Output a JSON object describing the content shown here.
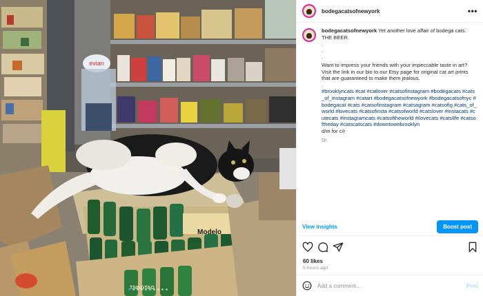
{
  "header": {
    "username": "bodegacatsofnewyork",
    "more_label": "•••"
  },
  "caption": {
    "username": "bodegacatsofnewyork",
    "line1": "Yet another love affair of bodega cats.",
    "line2": "THE BEER.",
    "dots": [
      ".",
      ".",
      "."
    ],
    "body": "Want to impress your friends with your impeccable taste in art? Visit the link in our bio to our Etsy page for original cat art prints that are guaranteed to make them jealous.",
    "dot4": ".",
    "hashtags": "#brooklyncats #cat #catlover #catsofinstagram #bodegacats #cats_of_instagram #catart #bodegacatsofnewyork #bodegacatsofnyc #bodegacat #cats #catsofinstagram #catsagram #catsofig #cats_of_world #lovecats #catsofinsta #catsofworld #catslover #instacats #cutecats #instagramcats #catsoftheworld #ilovecats #catslife #catsoftheday #catscatscats #downtownbrooklyn",
    "credit": "d/m for c/r",
    "time": "5h"
  },
  "insights": {
    "view_label": "View insights",
    "boost_label": "Boost post"
  },
  "actions": {
    "icons": [
      "heart-icon",
      "comment-icon",
      "share-icon",
      "bookmark-icon"
    ]
  },
  "likes": "60 likes",
  "time_ago": "5 hours ago",
  "comment": {
    "placeholder": "Add a comment...",
    "post_label": "Post"
  },
  "photo": {
    "signs": {
      "evian": "evian",
      "beer_brand": "Modelo",
      "beer_brand2": "TSINGTAO"
    },
    "carousel": {
      "count": 10,
      "active": 0
    }
  },
  "colors": {
    "accent": "#0095f6",
    "link": "#00376b",
    "muted": "#8e8e8e"
  }
}
